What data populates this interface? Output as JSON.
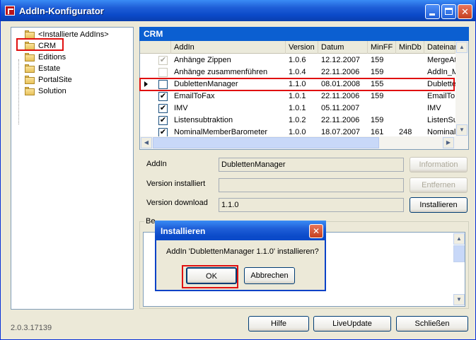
{
  "window": {
    "title": "AddIn-Konfigurator",
    "minimize": "_",
    "maximize": "□",
    "close": "✕"
  },
  "tree": {
    "items": [
      {
        "label": "<Installierte AddIns>"
      },
      {
        "label": "CRM"
      },
      {
        "label": "Editions"
      },
      {
        "label": "Estate"
      },
      {
        "label": "PortalSite"
      },
      {
        "label": "Solution"
      }
    ]
  },
  "crm": {
    "header": "CRM",
    "columns": {
      "addin": "AddIn",
      "version": "Version",
      "datum": "Datum",
      "minff": "MinFF",
      "mindb": "MinDb",
      "datei": "Dateinar"
    },
    "rows": [
      {
        "checked": "✔",
        "disabled": true,
        "addin": "Anhänge Zippen",
        "version": "1.0.6",
        "datum": "12.12.2007",
        "minff": "159",
        "mindb": "",
        "datei": "MergeAtt"
      },
      {
        "checked": "",
        "disabled": true,
        "addin": "Anhänge zusammenführen",
        "version": "1.0.4",
        "datum": "22.11.2006",
        "minff": "159",
        "mindb": "",
        "datei": "AddIn_M"
      },
      {
        "checked": "",
        "disabled": false,
        "addin": "DublettenManager",
        "version": "1.1.0",
        "datum": "08.01.2008",
        "minff": "155",
        "mindb": "",
        "datei": "Dublette"
      },
      {
        "checked": "✔",
        "disabled": false,
        "addin": "EmailToFax",
        "version": "1.0.1",
        "datum": "22.11.2006",
        "minff": "159",
        "mindb": "",
        "datei": "EmailToF"
      },
      {
        "checked": "✔",
        "disabled": false,
        "addin": "IMV",
        "version": "1.0.1",
        "datum": "05.11.2007",
        "minff": "",
        "mindb": "",
        "datei": "IMV"
      },
      {
        "checked": "✔",
        "disabled": false,
        "addin": "Listensubtraktion",
        "version": "1.0.2",
        "datum": "22.11.2006",
        "minff": "159",
        "mindb": "",
        "datei": "ListenSu"
      },
      {
        "checked": "✔",
        "disabled": false,
        "addin": "NominalMemberBarometer",
        "version": "1.0.0",
        "datum": "18.07.2007",
        "minff": "161",
        "mindb": "248",
        "datei": "NominalM"
      }
    ]
  },
  "details": {
    "addin_label": "AddIn",
    "addin_value": "DublettenManager",
    "installed_label": "Version installiert",
    "installed_value": "",
    "download_label": "Version download",
    "download_value": "1.1.0",
    "btn_information": "Information",
    "btn_entfernen": "Entfernen",
    "btn_installieren": "Installieren",
    "beschreibung_label": "Be"
  },
  "footer": {
    "version": "2.0.3.17139",
    "hilfe": "Hilfe",
    "liveupdate": "LiveUpdate",
    "schliessen": "Schließen"
  },
  "dialog": {
    "title": "Installieren",
    "message": "AddIn 'DublettenManager 1.1.0' installieren?",
    "ok": "OK",
    "cancel": "Abbrechen",
    "close": "✕"
  }
}
